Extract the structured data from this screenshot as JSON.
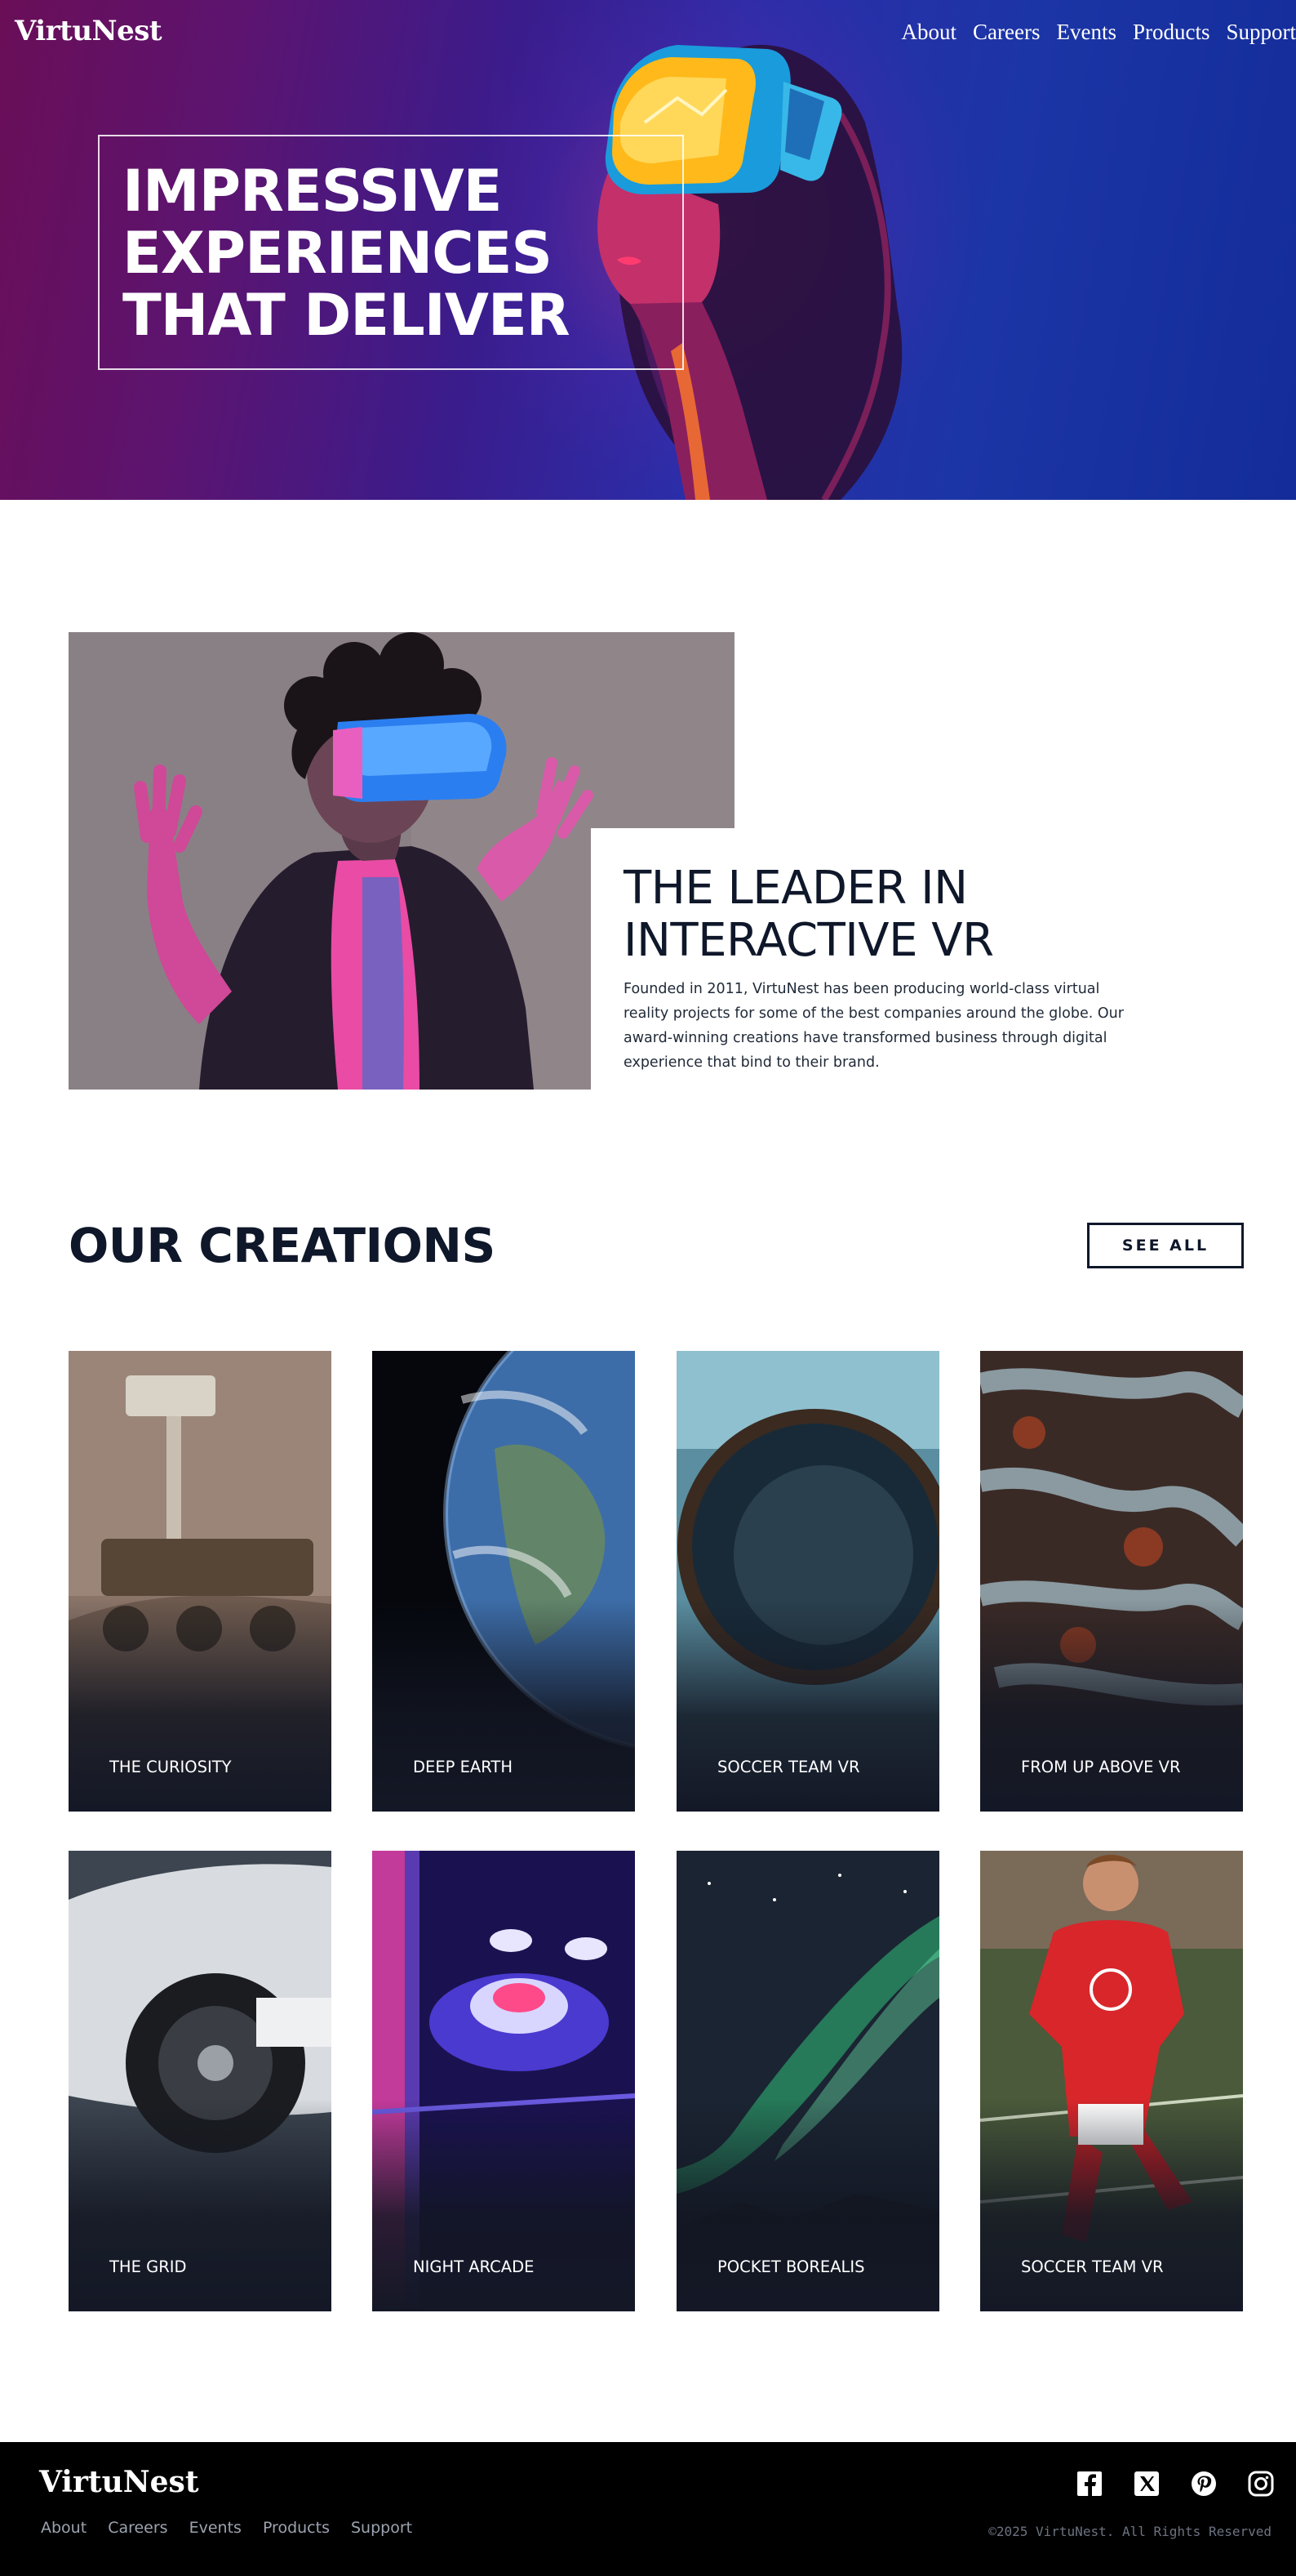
{
  "brand": "VirtuNest",
  "nav": [
    "About",
    "Careers",
    "Events",
    "Products",
    "Support"
  ],
  "hero": {
    "title_lines": [
      "IMPRESSIVE",
      "EXPERIENCES",
      "THAT DELIVER"
    ]
  },
  "about": {
    "title_lines": [
      "THE LEADER IN",
      "INTERACTIVE VR"
    ],
    "text": "Founded in 2011, VirtuNest has been producing world-class virtual reality projects for some of the best companies around the globe. Our award-winning creations have transformed business through digital experience that bind to their brand."
  },
  "creations": {
    "title": "OUR CREATIONS",
    "see_all": "SEE ALL",
    "items": [
      {
        "label": "THE CURIOSITY",
        "art": "mars-rover"
      },
      {
        "label": "DEEP EARTH",
        "art": "earth"
      },
      {
        "label": "SOCCER TEAM VR",
        "art": "stadium-sphere"
      },
      {
        "label": "FROM UP ABOVE VR",
        "art": "aerial-roads"
      },
      {
        "label": "THE GRID",
        "art": "race-car"
      },
      {
        "label": "NIGHT ARCADE",
        "art": "skeeball"
      },
      {
        "label": "POCKET BOREALIS",
        "art": "aurora"
      },
      {
        "label": "SOCCER TEAM VR",
        "art": "soccer-player"
      }
    ]
  },
  "footer": {
    "brand": "VirtuNest",
    "links": [
      "About",
      "Careers",
      "Events",
      "Products",
      "Support"
    ],
    "social": [
      "facebook-icon",
      "x-icon",
      "pinterest-icon",
      "instagram-icon"
    ],
    "copyright": "©2025 VirtuNest. All Rights Reserved"
  }
}
